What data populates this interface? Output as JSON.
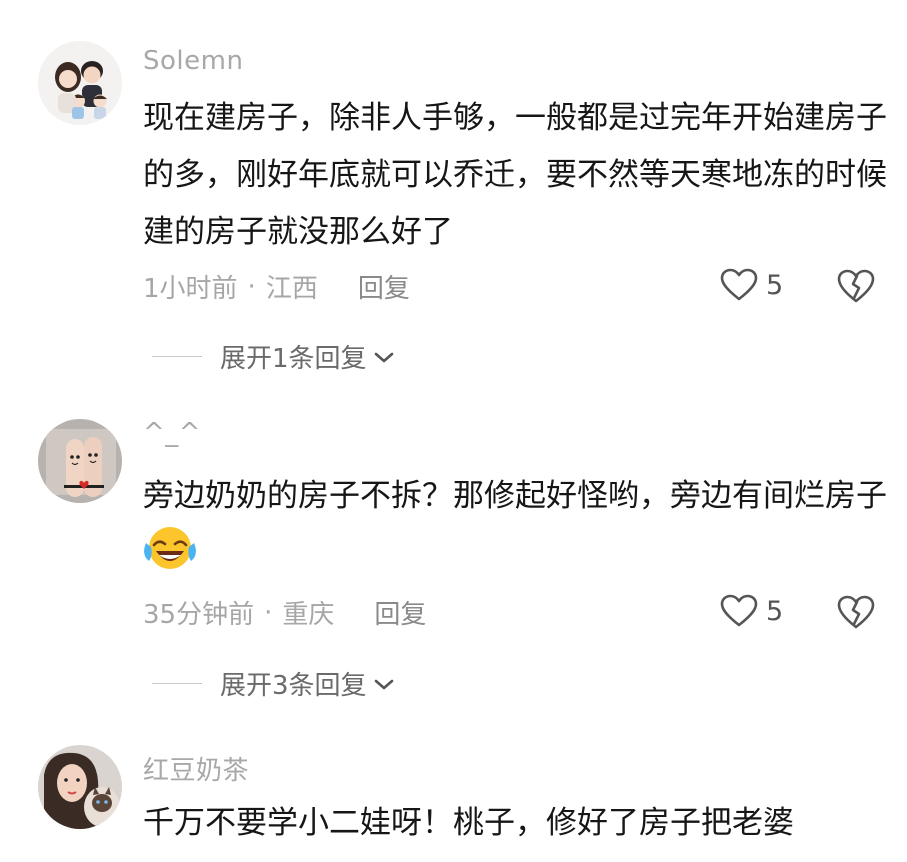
{
  "comments": [
    {
      "username": "Solemn",
      "text": "现在建房子，除非人手够，一般都是过完年开始建房子的多，刚好年底就可以乔迁，要不然等天寒地冻的时候建的房子就没那么好了",
      "time": "1小时前",
      "location": "江西",
      "reply_label": "回复",
      "likes": "5",
      "expand_label": "展开1条回复",
      "avatar_icon": "family-avatar-icon"
    },
    {
      "username": "^_^",
      "text": "旁边奶奶的房子不拆？那修起好怪哟，旁边有间烂房子",
      "time": "35分钟前",
      "location": "重庆",
      "reply_label": "回复",
      "likes": "5",
      "expand_label": "展开3条回复",
      "avatar_icon": "fingers-avatar-icon",
      "emoji": "laughing-crying-emoji"
    },
    {
      "username": "红豆奶茶",
      "text": "千万不要学小二娃呀！桃子，修好了房子把老婆",
      "avatar_icon": "woman-cat-avatar-icon"
    }
  ],
  "colors": {
    "username": "#a8a8a8",
    "text": "#161616",
    "meta": "#a6a6a6"
  }
}
